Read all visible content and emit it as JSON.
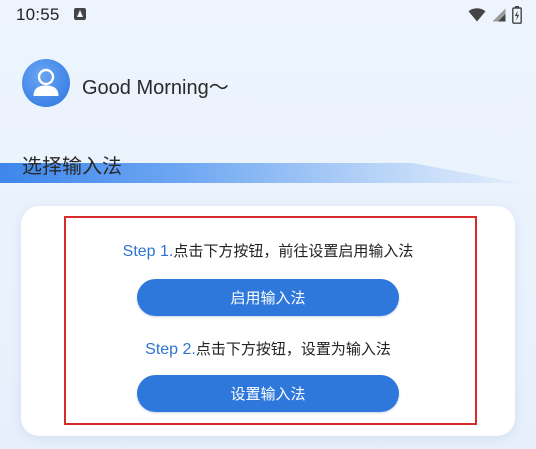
{
  "status_bar": {
    "time": "10:55",
    "icons": [
      "notification-icon",
      "wifi-icon",
      "cellular-signal-icon",
      "battery-icon"
    ]
  },
  "header": {
    "greeting": "Good Morning～"
  },
  "section": {
    "title": "选择输入法"
  },
  "steps": [
    {
      "label": "Step 1.",
      "text": "点击下方按钮，前往设置启用输入法",
      "button_label": "启用输入法"
    },
    {
      "label": "Step 2.",
      "text": "点击下方按钮，设置为输入法",
      "button_label": "设置输入法"
    }
  ],
  "colors": {
    "accent": "#2e78dc",
    "step_label": "#2e74d0",
    "highlight_border": "#d52b2b",
    "background": "#edf4fd",
    "card": "#ffffff"
  }
}
